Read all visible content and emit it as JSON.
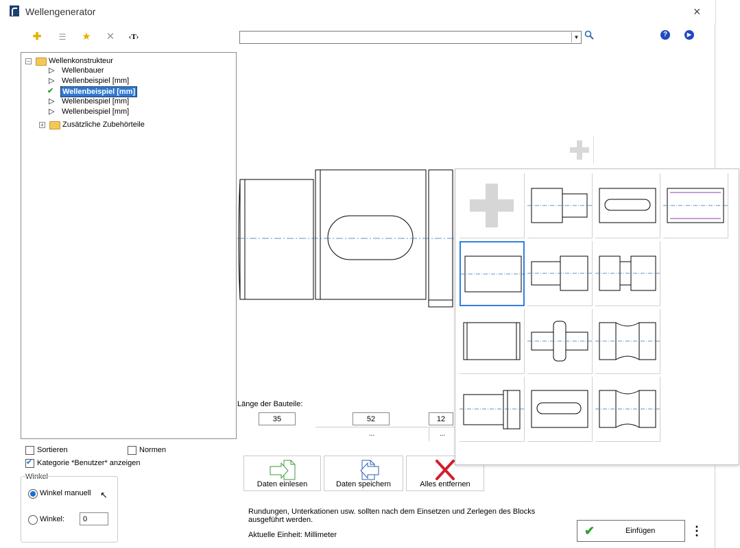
{
  "window": {
    "title": "Wellengenerator",
    "close": "×"
  },
  "toolbar": {
    "new_icon": "plus-icon",
    "edit_icon": "list-icon",
    "fav_icon": "star-icon",
    "delete_icon": "x-icon",
    "text_label": "‹T›"
  },
  "search": {
    "value": "",
    "help_icon": "?",
    "info_icon": "▶"
  },
  "tree": {
    "root": "Wellenkonstrukteur",
    "children": [
      "Wellenbauer",
      "Wellenbeispiel [mm]",
      "Wellenbeispiel [mm]",
      "Wellenbeispiel [mm]",
      "Wellenbeispiel [mm]"
    ],
    "second_root": "Zusätzliche Zubehörteile"
  },
  "options": {
    "sortieren": "Sortieren",
    "normen": "Normen",
    "kategorie": "Kategorie *Benutzer* anzeigen"
  },
  "winkel": {
    "legend": "Winkel",
    "manual": "Winkel manuell",
    "winkel_label": "Winkel:",
    "winkel_value": "0"
  },
  "lengths": {
    "label": "Länge der Bauteile:",
    "values": [
      "35",
      "52",
      "12"
    ],
    "dots": "..."
  },
  "buttons": {
    "read": "Daten einlesen",
    "save": "Daten speichern",
    "remove": "Alles entfernen"
  },
  "notes": {
    "hint": "Rundungen, Unterkationen usw. sollten nach dem Einsetzen und Zerlegen des Blocks ausgeführt werden.",
    "unit": "Aktuelle Einheit: Millimeter"
  },
  "insert": {
    "label": "Einfügen",
    "more": "⋮"
  },
  "colors": {
    "accent": "#2e7fe0",
    "remove": "#d0202a",
    "arrows": "#3a9a3a"
  }
}
